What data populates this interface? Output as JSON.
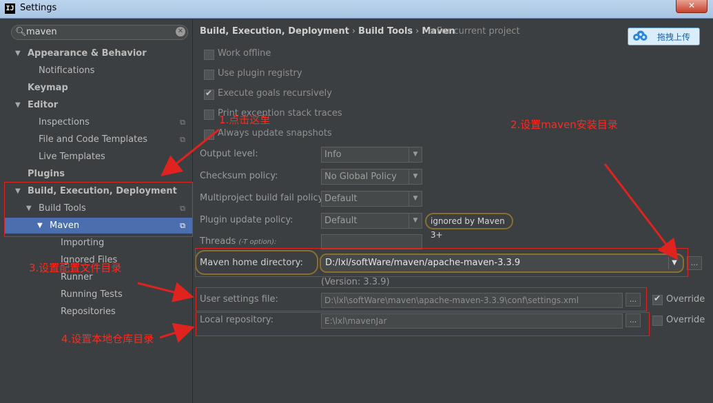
{
  "window": {
    "title": "Settings",
    "app_icon_text": "IJ",
    "close_label": "✕"
  },
  "search": {
    "value": "maven",
    "placeholder": ""
  },
  "sidebar": {
    "items": [
      {
        "label": "Appearance & Behavior",
        "level": 0,
        "expanded": true,
        "bold": true
      },
      {
        "label": "Notifications",
        "level": 1
      },
      {
        "label": "Keymap",
        "level": 0,
        "bold": true
      },
      {
        "label": "Editor",
        "level": 0,
        "expanded": true,
        "bold": true
      },
      {
        "label": "Inspections",
        "level": 1,
        "project_icon": true
      },
      {
        "label": "File and Code Templates",
        "level": 1,
        "project_icon": true
      },
      {
        "label": "Live Templates",
        "level": 1
      },
      {
        "label": "Plugins",
        "level": 0,
        "bold": true
      },
      {
        "label": "Build, Execution, Deployment",
        "level": 0,
        "expanded": true,
        "bold": true
      },
      {
        "label": "Build Tools",
        "level": 1,
        "expanded": true,
        "project_icon": true
      },
      {
        "label": "Maven",
        "level": 2,
        "expanded": true,
        "selected": true,
        "project_icon": true
      },
      {
        "label": "Importing",
        "level": 3
      },
      {
        "label": "Ignored Files",
        "level": 3
      },
      {
        "label": "Runner",
        "level": 3
      },
      {
        "label": "Running Tests",
        "level": 3
      },
      {
        "label": "Repositories",
        "level": 3
      }
    ]
  },
  "breadcrumb": {
    "part1": "Build, Execution, Deployment",
    "part2": "Build Tools",
    "part3": "Maven",
    "separator": "›",
    "note": "For current project"
  },
  "upload_button": {
    "label": "拖拽上传"
  },
  "options": {
    "work_offline": {
      "label": "Work offline",
      "checked": false
    },
    "use_plugin_registry": {
      "label": "Use plugin registry",
      "checked": false
    },
    "execute_goals_recursively": {
      "label": "Execute goals recursively",
      "checked": true
    },
    "print_exception": {
      "label": "Print exception stack traces",
      "checked": false
    },
    "always_update": {
      "label": "Always update snapshots",
      "checked": false
    }
  },
  "fields": {
    "output_level": {
      "label": "Output level:",
      "value": "Info"
    },
    "checksum_policy": {
      "label": "Checksum policy:",
      "value": "No Global Policy"
    },
    "multiproject_policy": {
      "label": "Multiproject build fail policy:",
      "value": "Default"
    },
    "plugin_update_policy": {
      "label": "Plugin update policy:",
      "value": "Default",
      "note": "ignored by Maven 3+"
    },
    "threads": {
      "label": "Threads",
      "hint": "(-T option):",
      "value": ""
    },
    "maven_home": {
      "label": "Maven home directory:",
      "value": "D:/lxl/softWare/maven/apache-maven-3.3.9",
      "version": "(Version: 3.3.9)"
    },
    "user_settings": {
      "label": "User settings file:",
      "value": "D:\\lxl\\softWare\\maven\\apache-maven-3.3.9\\conf\\settings.xml",
      "override_label": "Override",
      "override_checked": true
    },
    "local_repository": {
      "label": "Local repository:",
      "value": "E:\\lxl\\mavenJar",
      "override_label": "Override",
      "override_checked": false
    }
  },
  "browse_label": "...",
  "annotations": {
    "a1": "1.点击这里",
    "a2": "2.设置maven安装目录",
    "a3": "3.设置配置文件目录",
    "a4": "4.设置本地仓库目录"
  },
  "colors": {
    "background": "#3c3f41",
    "selection": "#4b6eaf",
    "annotation_red": "#ff2a1f",
    "highlight_gold": "#8a7030"
  }
}
